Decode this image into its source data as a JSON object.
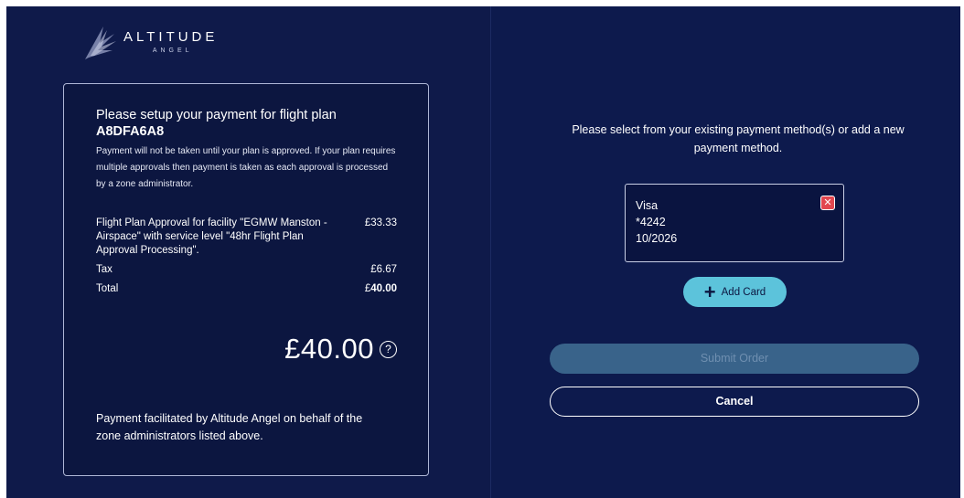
{
  "logo": {
    "title": "ALTITUDE",
    "subtitle": "ANGEL",
    "icon": "altitude-angel-wing-logo"
  },
  "summary": {
    "heading_prefix": "Please setup your payment for flight plan ",
    "flight_plan_id": "A8DFA6A8",
    "note": "Payment will not be taken until your plan is approved. If your plan requires multiple approvals then payment is taken as each approval is processed by a zone administrator.",
    "items": [
      {
        "description": "Flight Plan Approval for facility \"EGMW Manston - Airspace\" with service level \"48hr Flight Plan Approval Processing\".",
        "amount": "£33.33"
      },
      {
        "description": "Tax",
        "amount": "£6.67"
      }
    ],
    "total_label": "Total",
    "total_currency": "£",
    "total_value": "40.00",
    "big_total": "£40.00",
    "help_icon": "?",
    "footer": "Payment facilitated by Altitude Angel on behalf of the zone administrators listed above."
  },
  "payment": {
    "instructions": "Please select from your existing payment method(s) or add a new payment method.",
    "card": {
      "brand": "Visa",
      "number": "*4242",
      "expiry": "10/2026",
      "remove_icon": "close-icon"
    },
    "add_card_label": "Add Card",
    "submit_label": "Submit Order",
    "cancel_label": "Cancel"
  },
  "colors": {
    "background": "#0f1a4a",
    "accent": "#5cc3db",
    "submit_disabled": "#39638a",
    "danger": "#e2474f"
  }
}
